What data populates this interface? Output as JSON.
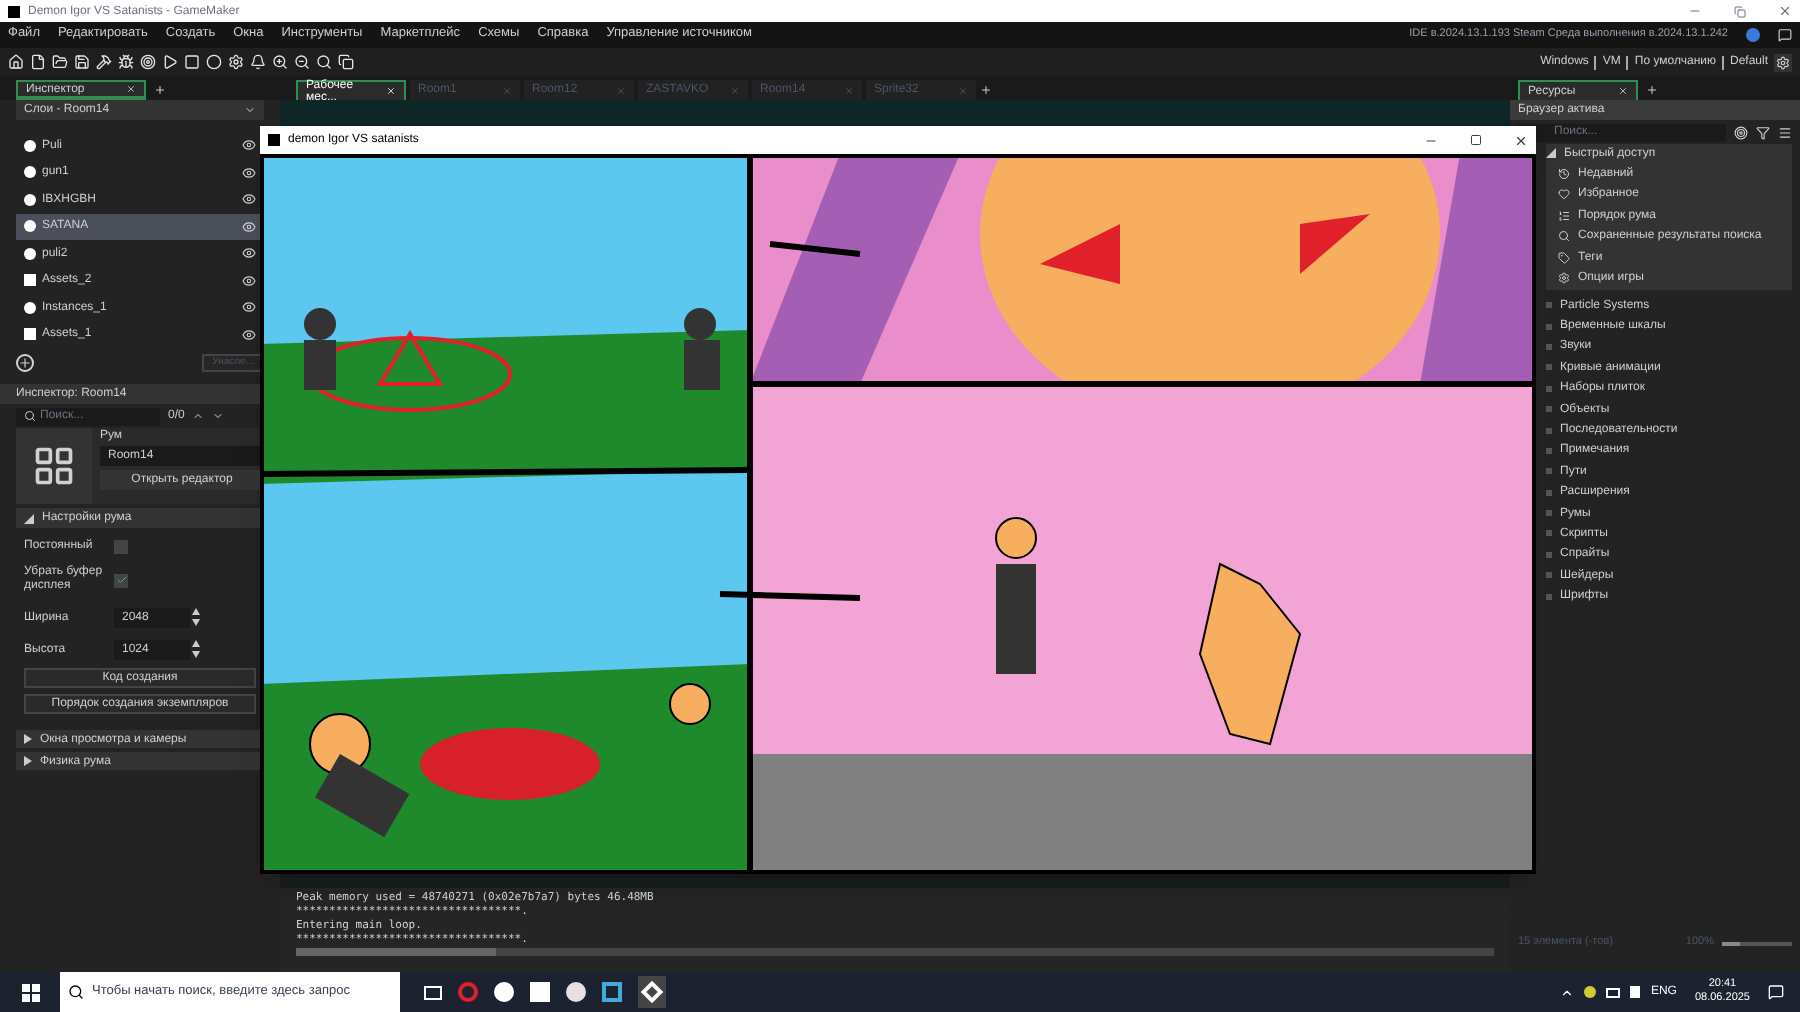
{
  "window": {
    "title": "Demon Igor VS Satanists - GameMaker"
  },
  "menu": [
    "Файл",
    "Редактировать",
    "Создать",
    "Окна",
    "Инструменты",
    "Маркетплейс",
    "Схемы",
    "Справка",
    "Управление источником"
  ],
  "version_info": "IDE в.2024.13.1.193 Steam  Среда выполнения в.2024.13.1.242",
  "targets": [
    "Windows",
    "VM",
    "По умолчанию",
    "Default"
  ],
  "left_tabs": [
    {
      "label": "Инспектор",
      "selected": true
    }
  ],
  "layers_dropdown": "Слои - Room14",
  "layers": [
    {
      "name": "Puli",
      "kind": "instance",
      "selected": false
    },
    {
      "name": "gun1",
      "kind": "instance",
      "selected": false
    },
    {
      "name": "IBXHGBH",
      "kind": "instance",
      "selected": false
    },
    {
      "name": "SATANA",
      "kind": "instance",
      "selected": true
    },
    {
      "name": "puli2",
      "kind": "instance",
      "selected": false
    },
    {
      "name": "Assets_2",
      "kind": "asset",
      "selected": false
    },
    {
      "name": "Instances_1",
      "kind": "instance",
      "selected": false
    },
    {
      "name": "Assets_1",
      "kind": "asset",
      "selected": false
    }
  ],
  "inherit_button": {
    "label": "Унасле...",
    "disabled": true
  },
  "inspector": {
    "title": "Инспектор: Room14",
    "search_placeholder": "Поиск...",
    "match_count": "0/0",
    "type_label": "Рум",
    "name_value": "Room14",
    "open_editor": "Открыть редактор",
    "section": {
      "label": "Настройки рума",
      "expanded": true
    },
    "persistent": {
      "label": "Постоянный",
      "checked": false
    },
    "clear_buffer": {
      "label": "Убрать буфер дисплея",
      "checked": true
    },
    "width": {
      "label": "Ширина",
      "value": "2048"
    },
    "height": {
      "label": "Высота",
      "value": "1024"
    },
    "buttons": [
      "Код создания",
      "Порядок создания экземпляров"
    ],
    "collapsed_sections": [
      {
        "label": "Окна просмотра и камеры",
        "expanded": false
      },
      {
        "label": "Физика рума",
        "expanded": false
      }
    ]
  },
  "doc_tabs": [
    {
      "label": "Рабочее мес...",
      "selected": true
    },
    {
      "label": "Room1",
      "selected": false
    },
    {
      "label": "Room12",
      "selected": false
    },
    {
      "label": "ZASTAVKO",
      "selected": false
    },
    {
      "label": "Room14",
      "selected": false
    },
    {
      "label": "Sprite32",
      "selected": false
    }
  ],
  "game_window": {
    "title": "demon Igor VS satanists"
  },
  "output": {
    "lines": [
      "Peak memory used = 48740271 (0x02e7b7a7) bytes 46.48MB",
      "**********************************.",
      "Entering main loop.",
      "**********************************."
    ]
  },
  "resources": {
    "tab": "Ресурсы",
    "browser": "Браузер актива",
    "search_placeholder": "Поиск...",
    "quick_access": {
      "label": "Быстрый доступ",
      "expanded": true,
      "children": [
        {
          "label": "Недавний",
          "kind": "recent"
        },
        {
          "label": "Избранное",
          "kind": "favorites"
        },
        {
          "label": "Порядок рума",
          "kind": "room_order"
        },
        {
          "label": "Сохраненные результаты поиска",
          "kind": "saved_search"
        },
        {
          "label": "Теги",
          "kind": "tags"
        },
        {
          "label": "Опции игры",
          "kind": "game_options"
        }
      ]
    },
    "folders": [
      "Particle Systems",
      "Временные шкалы",
      "Звуки",
      "Кривые анимации",
      "Наборы плиток",
      "Объекты",
      "Последовательности",
      "Примечания",
      "Пути",
      "Расширения",
      "Румы",
      "Скрипты",
      "Спрайты",
      "Шейдеры",
      "Шрифты"
    ],
    "status": "15 элемента (-тов)",
    "zoom": "100%",
    "zoom_slider": {
      "level": 0.25
    }
  },
  "taskbar": {
    "search_placeholder": "Чтобы начать поиск, введите здесь запрос",
    "language": "ENG",
    "time": "20:41",
    "date": "08.06.2025"
  }
}
